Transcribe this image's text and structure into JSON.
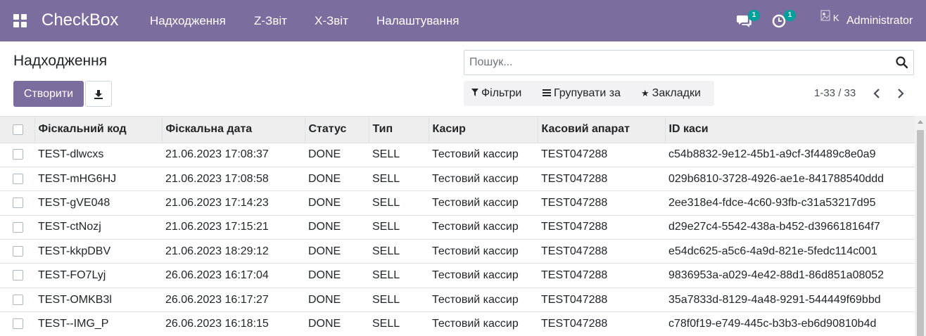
{
  "navbar": {
    "brand": "CheckBox",
    "menu": [
      "Надходження",
      "Z-Звіт",
      "X-Звіт",
      "Налаштування"
    ],
    "messages_badge": "1",
    "activity_badge": "1",
    "avatar_alt": "K",
    "user": "Administrator",
    "color": "#7c6d9f"
  },
  "control": {
    "title": "Надходження",
    "create_label": "Створити",
    "search_placeholder": "Пошук...",
    "filters_label": "Фільтри",
    "groupby_label": "Групувати за",
    "favorites_label": "Закладки",
    "pager": "1-33 / 33"
  },
  "table": {
    "columns": [
      "Фіскальний код",
      "Фіскальна дата",
      "Статус",
      "Тип",
      "Касир",
      "Касовий апарат",
      "ID каси"
    ],
    "rows": [
      [
        "TEST-dlwcxs",
        "21.06.2023 17:08:37",
        "DONE",
        "SELL",
        "Тестовий кассир",
        "TEST047288",
        "c54b8832-9e12-45b1-a9cf-3f4489c8e0a9"
      ],
      [
        "TEST-mHG6HJ",
        "21.06.2023 17:08:58",
        "DONE",
        "SELL",
        "Тестовий кассир",
        "TEST047288",
        "029b6810-3728-4926-ae1e-841788540ddd"
      ],
      [
        "TEST-gVE048",
        "21.06.2023 17:14:23",
        "DONE",
        "SELL",
        "Тестовий кассир",
        "TEST047288",
        "2ee318e4-fdce-4c60-93fb-c31a53217d95"
      ],
      [
        "TEST-ctNozj",
        "21.06.2023 17:15:21",
        "DONE",
        "SELL",
        "Тестовий кассир",
        "TEST047288",
        "d29e27c4-5542-438a-b452-d396618164f7"
      ],
      [
        "TEST-kkpDBV",
        "21.06.2023 18:29:12",
        "DONE",
        "SELL",
        "Тестовий кассир",
        "TEST047288",
        "e54dc625-a5c6-4a9d-821e-5fedc114c001"
      ],
      [
        "TEST-FO7Lyj",
        "26.06.2023 16:17:04",
        "DONE",
        "SELL",
        "Тестовий кассир",
        "TEST047288",
        "9836953a-a029-4e42-88d1-86d851a08052"
      ],
      [
        "TEST-OMKB3l",
        "26.06.2023 16:17:27",
        "DONE",
        "SELL",
        "Тестовий кассир",
        "TEST047288",
        "35a7833d-8129-4a48-9291-544449f69bbd"
      ],
      [
        "TEST--IMG_P",
        "26.06.2023 16:18:15",
        "DONE",
        "SELL",
        "Тестовий кассир",
        "TEST047288",
        "c78f0f19-e749-445c-b3b3-eb6d90810b4d"
      ]
    ]
  }
}
